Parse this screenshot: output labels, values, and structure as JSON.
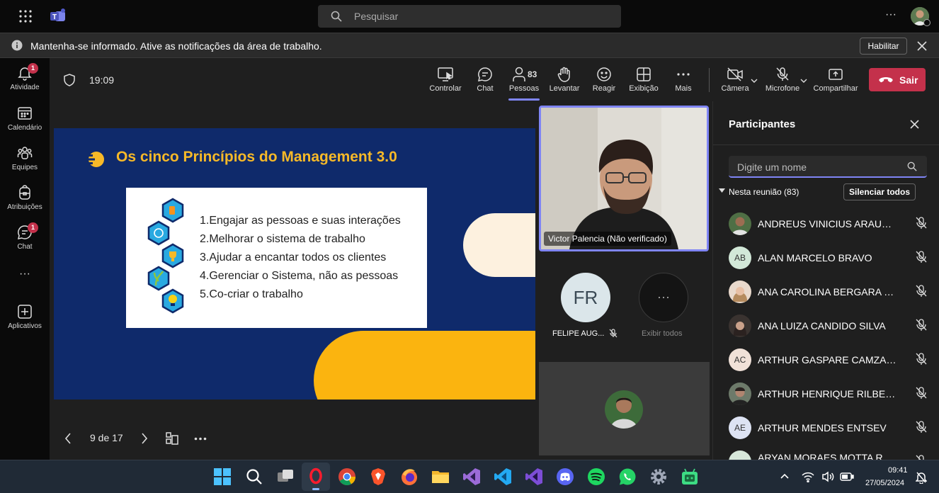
{
  "topbar": {
    "search_placeholder": "Pesquisar",
    "more_label": "···"
  },
  "notification": {
    "text": "Mantenha-se informado. Ative as notificações da área de trabalho.",
    "enable_label": "Habilitar"
  },
  "rail": {
    "items": [
      {
        "label": "Atividade",
        "badge": "1"
      },
      {
        "label": "Calendário"
      },
      {
        "label": "Equipes"
      },
      {
        "label": "Atribuições"
      },
      {
        "label": "Chat",
        "badge": "1"
      },
      {
        "label": "···"
      },
      {
        "label": "Aplicativos"
      }
    ]
  },
  "meeting": {
    "timer": "19:09",
    "controls": {
      "share_control": "Controlar",
      "chat": "Chat",
      "people": "Pessoas",
      "people_count": "83",
      "raise": "Levantar",
      "react": "Reagir",
      "view": "Exibição",
      "more": "Mais",
      "camera": "Câmera",
      "mic": "Microfone",
      "share": "Compartilhar",
      "leave": "Sair"
    }
  },
  "slide": {
    "title": "Os cinco Princípios do Management 3.0",
    "items": [
      "1.Engajar as pessoas e suas interações",
      "2.Melhorar o sistema de trabalho",
      "3.Ajudar a encantar todos os clientes",
      "4.Gerenciar o Sistema, não as pessoas",
      "5.Co-criar o trabalho"
    ],
    "page": "9 de 17"
  },
  "gallery": {
    "speaker_name": "Victor Palencia (Não verificado)",
    "tile_initials": "FR",
    "tile_name": "FELIPE AUG...",
    "view_all_label": "Exibir todos",
    "view_all_icon": "···"
  },
  "participants": {
    "title": "Participantes",
    "search_placeholder": "Digite um nome",
    "section_label": "Nesta reunião (83)",
    "mute_all_label": "Silenciar todos",
    "people": [
      {
        "name": "ANDREUS VINICIUS ARAUJO ...",
        "initials": "",
        "photo": true
      },
      {
        "name": "ALAN MARCELO BRAVO",
        "initials": "AB",
        "photo": false
      },
      {
        "name": "ANA CAROLINA BERGARA SC...",
        "initials": "",
        "photo": true
      },
      {
        "name": "ANA LUIZA CANDIDO SILVA",
        "initials": "",
        "photo": true
      },
      {
        "name": "ARTHUR GASPARE CAMZANO",
        "initials": "AC",
        "photo": false
      },
      {
        "name": "ARTHUR HENRIQUE RILBER D...",
        "initials": "",
        "photo": true
      },
      {
        "name": "ARTHUR MENDES ENTSEV",
        "initials": "AE",
        "photo": false
      },
      {
        "name": "ARYAN MORAES MOTTA RUAS",
        "initials": "",
        "photo": false
      }
    ]
  },
  "taskbar": {
    "time": "09:41",
    "date": "27/05/2024"
  },
  "colors": {
    "accent": "#7f85f5",
    "leave": "#c4314b",
    "slide_bg": "#0f2a6b",
    "slide_title": "#f7b928"
  }
}
